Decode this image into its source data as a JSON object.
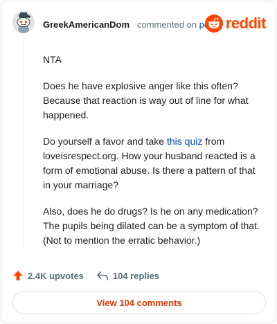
{
  "comment": {
    "author": "GreekAmericanDom",
    "action_text": "commented on",
    "post_link": "post",
    "paragraphs": {
      "p1": "NTA",
      "p2": "Does he have explosive anger like this often? Because that reaction is way out of line for what happened.",
      "p3_before": "Do yourself a favor and take ",
      "p3_link": "this quiz",
      "p3_after": " from loveisrespect.org. How your husband reacted is a form of emotional abuse. Is there a pattern of that in your marriage?",
      "p4": "Also, does he do drugs? Is he on any medication? The pupils being dilated can be a symptom of that. (Not to mention the erratic behavior.)"
    }
  },
  "brand": {
    "wordmark": "reddit",
    "color": "#ff4500"
  },
  "actions": {
    "upvotes": "2.4K upvotes",
    "replies": "104 replies",
    "upvote_icon_color": "#ff4500"
  },
  "footer": {
    "view_comments": "View 104 comments"
  },
  "icons": {
    "avatar": "snoo-avatar-icon",
    "logo": "reddit-alien-icon",
    "upvote": "upvote-arrow-icon",
    "reply": "reply-arrow-icon"
  }
}
